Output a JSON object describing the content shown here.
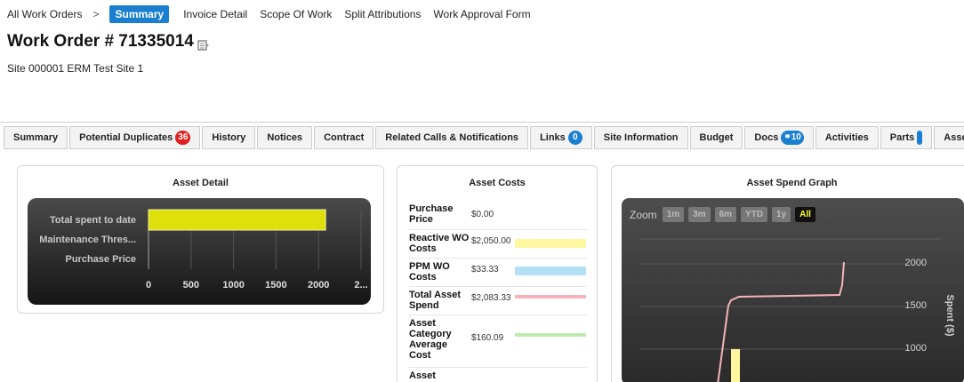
{
  "topnav": {
    "items": [
      "All Work Orders",
      "Summary",
      "Invoice Detail",
      "Scope Of Work",
      "Split Attributions",
      "Work Approval Form"
    ],
    "separator": ">"
  },
  "header": {
    "title": "Work Order # 71335014",
    "site": "Site 000001 ERM Test Site 1"
  },
  "tabs": [
    {
      "label": "Summary"
    },
    {
      "label": "Potential Duplicates",
      "badge": "36"
    },
    {
      "label": "History"
    },
    {
      "label": "Notices"
    },
    {
      "label": "Contract"
    },
    {
      "label": "Related Calls & Notifications"
    },
    {
      "label": "Links",
      "badge": "0"
    },
    {
      "label": "Site Information"
    },
    {
      "label": "Budget"
    },
    {
      "label": "Docs",
      "badge": "10"
    },
    {
      "label": "Activities"
    },
    {
      "label": "Parts"
    },
    {
      "label": "Asset Specificati"
    }
  ],
  "asset_detail": {
    "title": "Asset Detail",
    "categories": [
      "Total spent to date",
      "Maintenance Thres...",
      "Purchase Price"
    ],
    "values": [
      2083.33,
      0,
      0
    ],
    "ticks": [
      "0",
      "500",
      "1000",
      "1500",
      "2000",
      "2..."
    ],
    "bar_color": "#dfe00b"
  },
  "asset_costs": {
    "title": "Asset Costs",
    "rows": [
      {
        "label": "Purchase Price",
        "value": "$0.00",
        "color": ""
      },
      {
        "label": "Reactive WO Costs",
        "value": "$2,050.00",
        "color": "#fff7a0"
      },
      {
        "label": "PPM WO Costs",
        "value": "$33.33",
        "color": "#b3e0f5"
      },
      {
        "label": "Total Asset Spend",
        "value": "$2,083.33",
        "color": "#f7b3b8"
      },
      {
        "label": "Asset Category Average Cost",
        "value": "$160.09",
        "color": "#bdecaa"
      },
      {
        "label": "Asset",
        "value": "",
        "color": ""
      }
    ]
  },
  "spend_graph": {
    "title": "Asset Spend Graph",
    "zoom_label": "Zoom",
    "zoom_buttons": [
      "1m",
      "3m",
      "6m",
      "YTD",
      "1y",
      "All"
    ],
    "active_zoom": "All",
    "y_ticks": [
      "2000",
      "1500",
      "1000"
    ],
    "y_label": "Spent ($)",
    "line_color": "#f7b3b8",
    "bar_color": "#fff7a0"
  }
}
